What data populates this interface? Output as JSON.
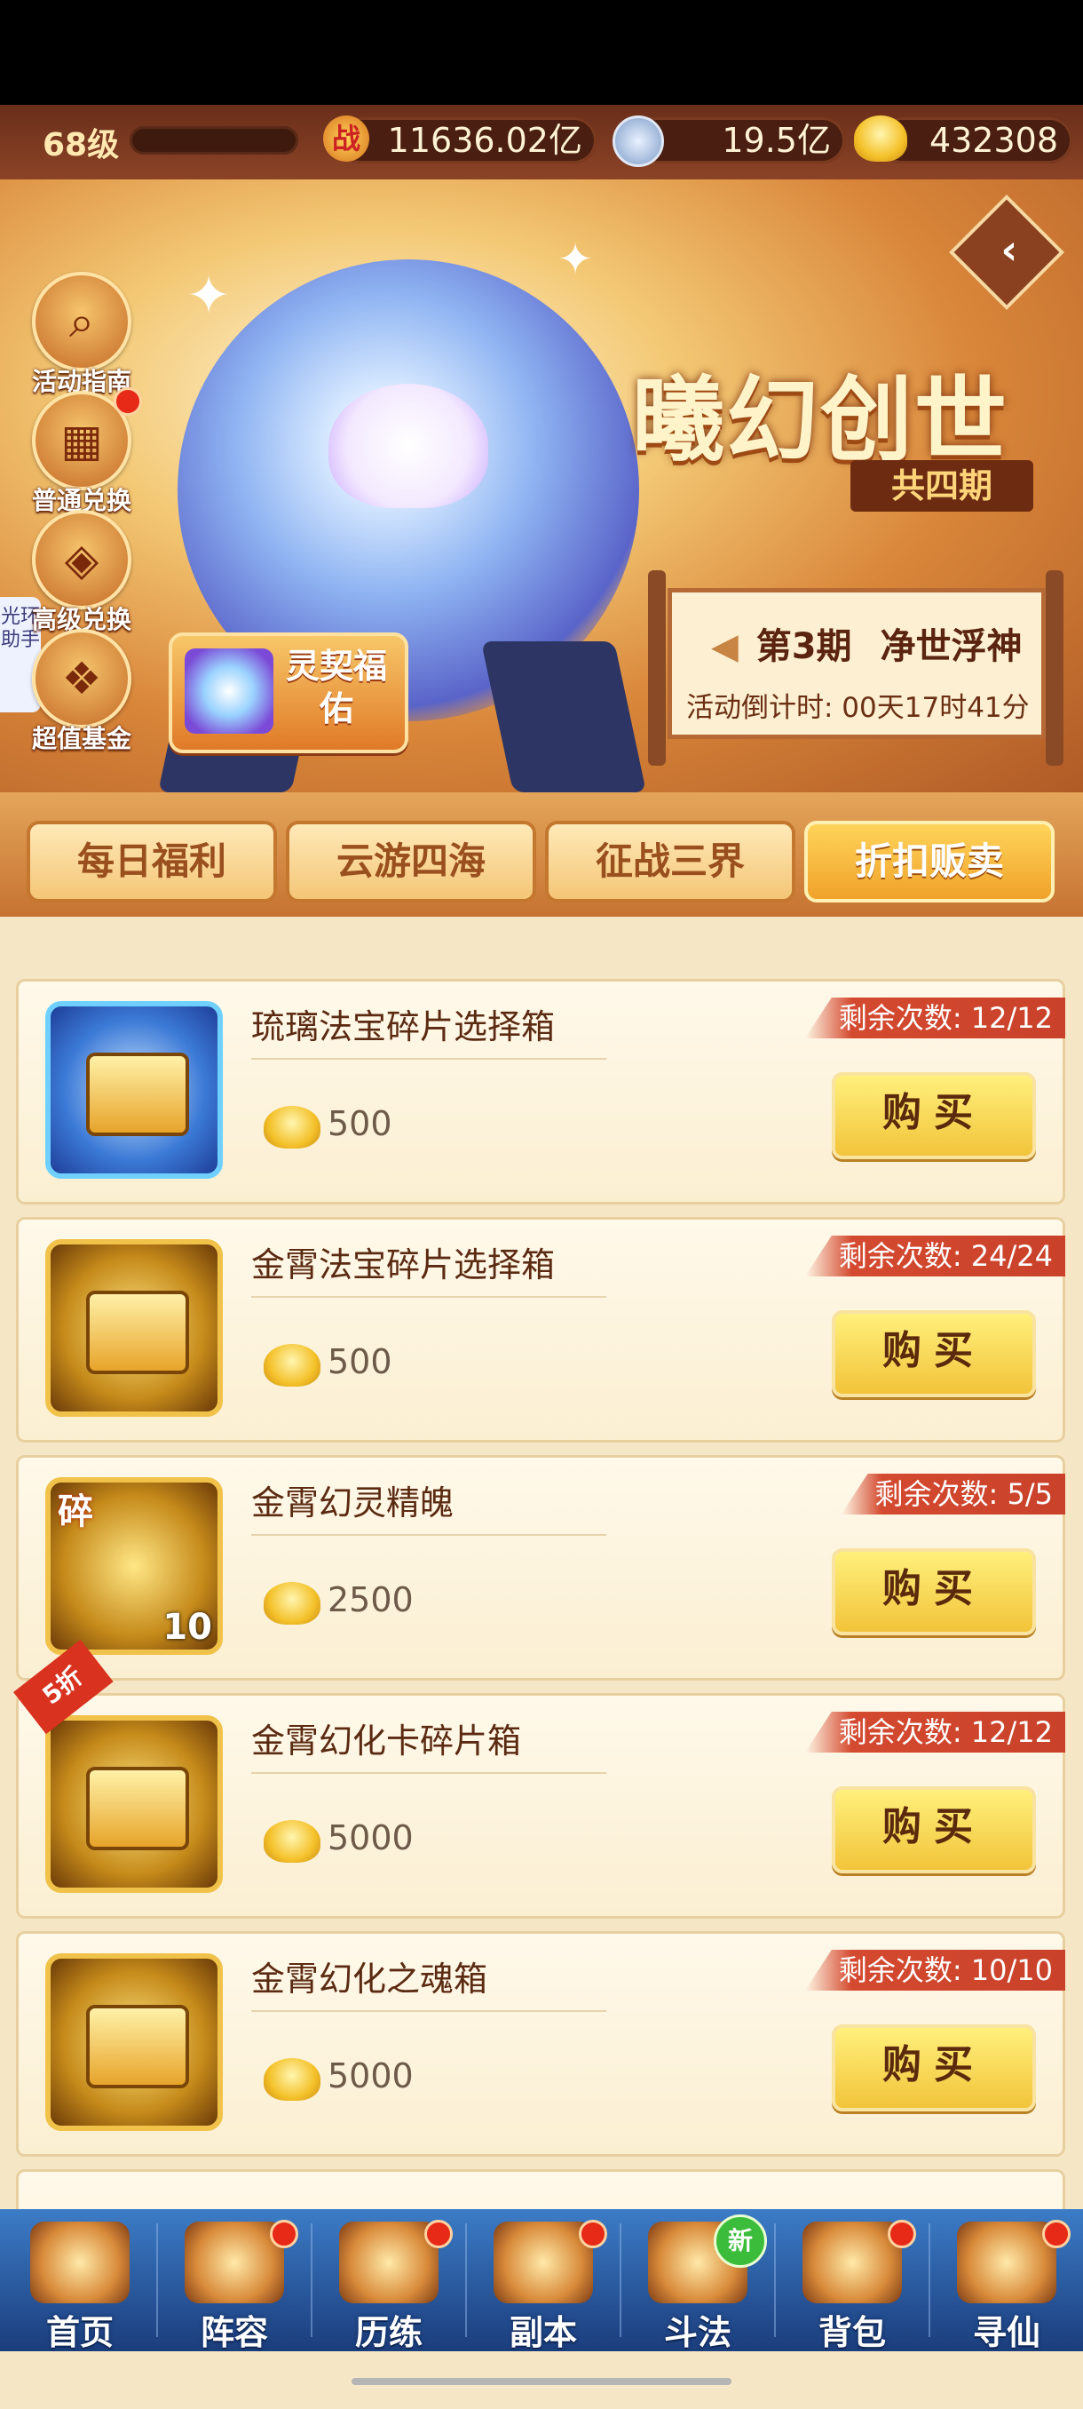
{
  "topbar": {
    "level": "68级",
    "power_icon": "战",
    "power": "11636.02亿",
    "silver": "19.5亿",
    "gold": "432308"
  },
  "hero": {
    "title": "曦幻创世",
    "periods": "共四期",
    "period_label": "第3期",
    "period_name": "净世浮神",
    "countdown": "活动倒计时: 00天17时41分",
    "lingqi": "灵契福佑",
    "back_icon": "chevron-left-icon"
  },
  "side_buttons": [
    {
      "label": "活动指南",
      "icon": "magnifier-icon"
    },
    {
      "label": "普通兑换",
      "icon": "gift-box-icon"
    },
    {
      "label": "高级兑换",
      "icon": "present-icon"
    },
    {
      "label": "超值基金",
      "icon": "treasure-icon"
    }
  ],
  "assistant_label": "光环助手",
  "tabs": [
    "每日福利",
    "云游四海",
    "征战三界",
    "折扣贩卖"
  ],
  "active_tab": "折扣贩卖",
  "items": [
    {
      "name": "琉璃法宝碎片选择箱",
      "price": "500",
      "remaining": "剩余次数: 12/12",
      "buy": "购买"
    },
    {
      "name": "金霄法宝碎片选择箱",
      "price": "500",
      "remaining": "剩余次数: 24/24",
      "buy": "购买"
    },
    {
      "name": "金霄幻灵精魄",
      "price": "2500",
      "remaining": "剩余次数: 5/5",
      "buy": "购买",
      "fragment_tag": "碎",
      "count": "10"
    },
    {
      "name": "金霄幻化卡碎片箱",
      "price": "5000",
      "remaining": "剩余次数: 12/12",
      "buy": "购买",
      "discount": "5折"
    },
    {
      "name": "金霄幻化之魂箱",
      "price": "5000",
      "remaining": "剩余次数: 10/10",
      "buy": "购买"
    }
  ],
  "nav": [
    {
      "label": "首页",
      "dot": false
    },
    {
      "label": "阵容",
      "dot": true
    },
    {
      "label": "历练",
      "dot": true
    },
    {
      "label": "副本",
      "dot": true
    },
    {
      "label": "斗法",
      "dot": false,
      "new": "新"
    },
    {
      "label": "背包",
      "dot": true
    },
    {
      "label": "寻仙",
      "dot": true
    }
  ]
}
